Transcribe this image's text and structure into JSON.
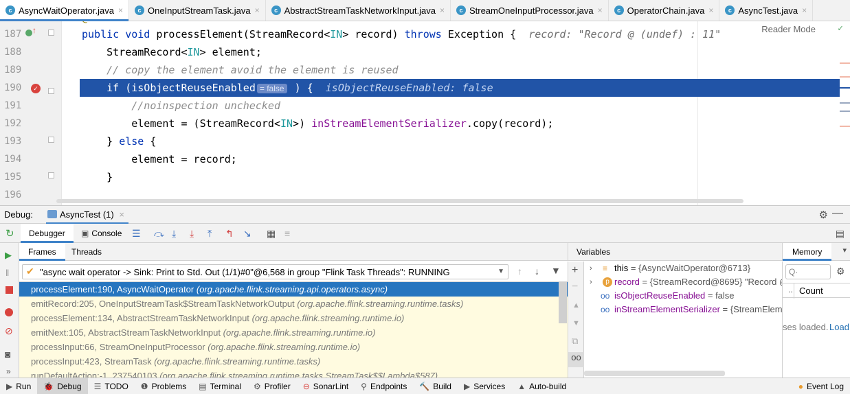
{
  "tabs": [
    {
      "label": "AsyncWaitOperator.java",
      "active": true
    },
    {
      "label": "OneInputStreamTask.java",
      "active": false
    },
    {
      "label": "AbstractStreamTaskNetworkInput.java",
      "active": false
    },
    {
      "label": "StreamOneInputProcessor.java",
      "active": false
    },
    {
      "label": "OperatorChain.java",
      "active": false
    },
    {
      "label": "AsyncTest.java",
      "active": false
    }
  ],
  "editor": {
    "reader_mode": "Reader Mode",
    "lines": [
      {
        "num": "187",
        "parts": [
          [
            "kw",
            "public "
          ],
          [
            "kw",
            "void "
          ],
          [
            "",
            "processElement(StreamRecord<"
          ],
          [
            "gen",
            "IN"
          ],
          [
            "",
            "> record) "
          ],
          [
            "kw",
            "throws "
          ],
          [
            "",
            "Exception {  "
          ],
          [
            "hint",
            "record: \"Record @ (undef) : 11\""
          ]
        ]
      },
      {
        "num": "188",
        "parts": [
          [
            "",
            "    StreamRecord<"
          ],
          [
            "gen",
            "IN"
          ],
          [
            "",
            "> element;"
          ]
        ]
      },
      {
        "num": "189",
        "parts": [
          [
            "cmt",
            "    // copy the element avoid the element is reused"
          ]
        ]
      },
      {
        "num": "190",
        "parts": [
          [
            "",
            "    "
          ],
          [
            "kw",
            "if "
          ],
          [
            "",
            "(isObjectReuseEnabled"
          ],
          [
            "inlay",
            "= false"
          ],
          [
            "",
            " ) {  "
          ],
          [
            "hint",
            "isObjectReuseEnabled: false"
          ]
        ]
      },
      {
        "num": "191",
        "parts": [
          [
            "cmt",
            "        //noinspection unchecked"
          ]
        ]
      },
      {
        "num": "192",
        "parts": [
          [
            "",
            "        element = (StreamRecord<"
          ],
          [
            "gen",
            "IN"
          ],
          [
            "",
            ">) "
          ],
          [
            "fld",
            "inStreamElementSerializer"
          ],
          [
            "",
            ".copy(record);"
          ]
        ]
      },
      {
        "num": "193",
        "parts": [
          [
            "",
            "    } "
          ],
          [
            "kw",
            "else "
          ],
          [
            "",
            "{"
          ]
        ]
      },
      {
        "num": "194",
        "parts": [
          [
            "",
            "        element = record;"
          ]
        ]
      },
      {
        "num": "195",
        "parts": [
          [
            "",
            "    }"
          ]
        ]
      },
      {
        "num": "196",
        "parts": []
      }
    ]
  },
  "debug": {
    "label": "Debug:",
    "session_tab": "AsyncTest (1)",
    "debugger_tab": "Debugger",
    "console_tab": "Console",
    "frames_tab": "Frames",
    "threads_tab": "Threads",
    "thread": "\"async wait operator -> Sink: Print to Std. Out (1/1)#0\"@6,568 in group \"Flink Task Threads\": RUNNING",
    "frames": [
      {
        "method": "processElement:190, AsyncWaitOperator",
        "pkg": "(org.apache.flink.streaming.api.operators.async)"
      },
      {
        "method": "emitRecord:205, OneInputStreamTask$StreamTaskNetworkOutput",
        "pkg": "(org.apache.flink.streaming.runtime.tasks)"
      },
      {
        "method": "processElement:134, AbstractStreamTaskNetworkInput",
        "pkg": "(org.apache.flink.streaming.runtime.io)"
      },
      {
        "method": "emitNext:105, AbstractStreamTaskNetworkInput",
        "pkg": "(org.apache.flink.streaming.runtime.io)"
      },
      {
        "method": "processInput:66, StreamOneInputProcessor",
        "pkg": "(org.apache.flink.streaming.runtime.io)"
      },
      {
        "method": "processInput:423, StreamTask",
        "pkg": "(org.apache.flink.streaming.runtime.tasks)"
      },
      {
        "method": "runDefaultAction:-1, 237540103",
        "pkg": "(org.apache.flink.streaming.runtime.tasks.StreamTask$$Lambda$587)"
      }
    ],
    "variables_label": "Variables",
    "variables": [
      {
        "name": "this",
        "value": " = {AsyncWaitOperator@6713}"
      },
      {
        "name": "record",
        "value": " = {StreamRecord@8695} \"Record @"
      },
      {
        "name": "isObjectReuseEnabled",
        "value": " = false"
      },
      {
        "name": "inStreamElementSerializer",
        "value": " = {StreamEleme"
      }
    ],
    "memory_label": "Memory",
    "memory_count": "Count",
    "memory_loaded": "ses loaded.",
    "memory_load": "Load"
  },
  "statusbar": [
    {
      "label": "Run",
      "icon": "▶"
    },
    {
      "label": "Debug",
      "icon": "🐞"
    },
    {
      "label": "TODO",
      "icon": "☰"
    },
    {
      "label": "Problems",
      "icon": "❶"
    },
    {
      "label": "Terminal",
      "icon": "▤"
    },
    {
      "label": "Profiler",
      "icon": "⚙"
    },
    {
      "label": "SonarLint",
      "icon": "⊖"
    },
    {
      "label": "Endpoints",
      "icon": "⚲"
    },
    {
      "label": "Build",
      "icon": "🔨"
    },
    {
      "label": "Services",
      "icon": "▶"
    },
    {
      "label": "Auto-build",
      "icon": "▲"
    },
    {
      "label": "Event Log",
      "icon": "●"
    }
  ]
}
